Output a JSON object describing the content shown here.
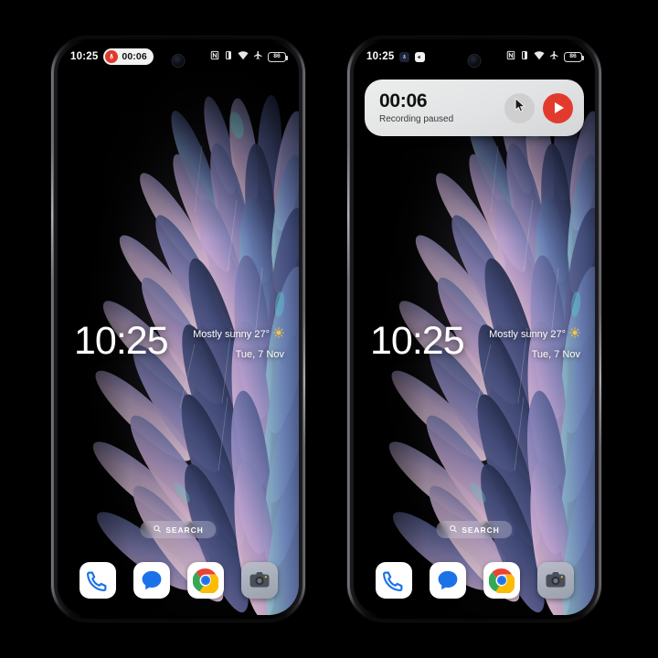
{
  "scene": {
    "background_color": "#000000",
    "device_count": 2
  },
  "phones": [
    {
      "id": "left",
      "state_label": "recording-in-progress-status-pill",
      "status_bar": {
        "time": "10:25",
        "recording_pill": {
          "time": "00:06",
          "icon": "microphone-icon",
          "accent": "#e0392b"
        },
        "icons": [
          "nfc-icon",
          "vibrate-icon",
          "wifi-icon",
          "airplane-mode-icon"
        ],
        "battery": {
          "level": "86",
          "icon": "battery-icon"
        }
      },
      "notification_card": null,
      "lockscreen": {
        "clock": "10:25",
        "weather": "Mostly sunny 27°",
        "weather_icon": "sun-icon",
        "date": "Tue, 7 Nov"
      },
      "search": {
        "label": "SEARCH",
        "icon": "search-icon"
      },
      "dock": [
        {
          "name": "phone-app",
          "icon": "phone-icon"
        },
        {
          "name": "messages-app",
          "icon": "chat-bubble-icon"
        },
        {
          "name": "chrome-app",
          "icon": "chrome-icon"
        },
        {
          "name": "camera-app",
          "icon": "camera-icon"
        }
      ]
    },
    {
      "id": "right",
      "state_label": "recording-paused-notification-card",
      "status_bar": {
        "time": "10:25",
        "recording_pill": null,
        "notif_icons": [
          "recorder-app-icon",
          "speaker-icon"
        ],
        "icons": [
          "nfc-icon",
          "vibrate-icon",
          "wifi-icon",
          "airplane-mode-icon"
        ],
        "battery": {
          "level": "86",
          "icon": "battery-icon"
        }
      },
      "notification_card": {
        "time": "00:06",
        "subtitle": "Recording paused",
        "secondary_button": {
          "name": "stop-button",
          "icon": "cursor-pointer-icon",
          "color": "#cfcfcf"
        },
        "primary_button": {
          "name": "resume-recording-button",
          "icon": "play-icon",
          "color": "#e23b2e"
        }
      },
      "lockscreen": {
        "clock": "10:25",
        "weather": "Mostly sunny 27°",
        "weather_icon": "sun-icon",
        "date": "Tue, 7 Nov"
      },
      "search": {
        "label": "SEARCH",
        "icon": "search-icon"
      },
      "dock": [
        {
          "name": "phone-app",
          "icon": "phone-icon"
        },
        {
          "name": "messages-app",
          "icon": "chat-bubble-icon"
        },
        {
          "name": "chrome-app",
          "icon": "chrome-icon"
        },
        {
          "name": "camera-app",
          "icon": "camera-icon"
        }
      ]
    }
  ],
  "wallpaper": {
    "name": "iridescent-feathers",
    "colors": [
      "#000000",
      "#7b6fa8",
      "#5f7fa8",
      "#d9a4bb",
      "#2c3c63",
      "#9ad6d6",
      "#e8c9d8"
    ]
  }
}
